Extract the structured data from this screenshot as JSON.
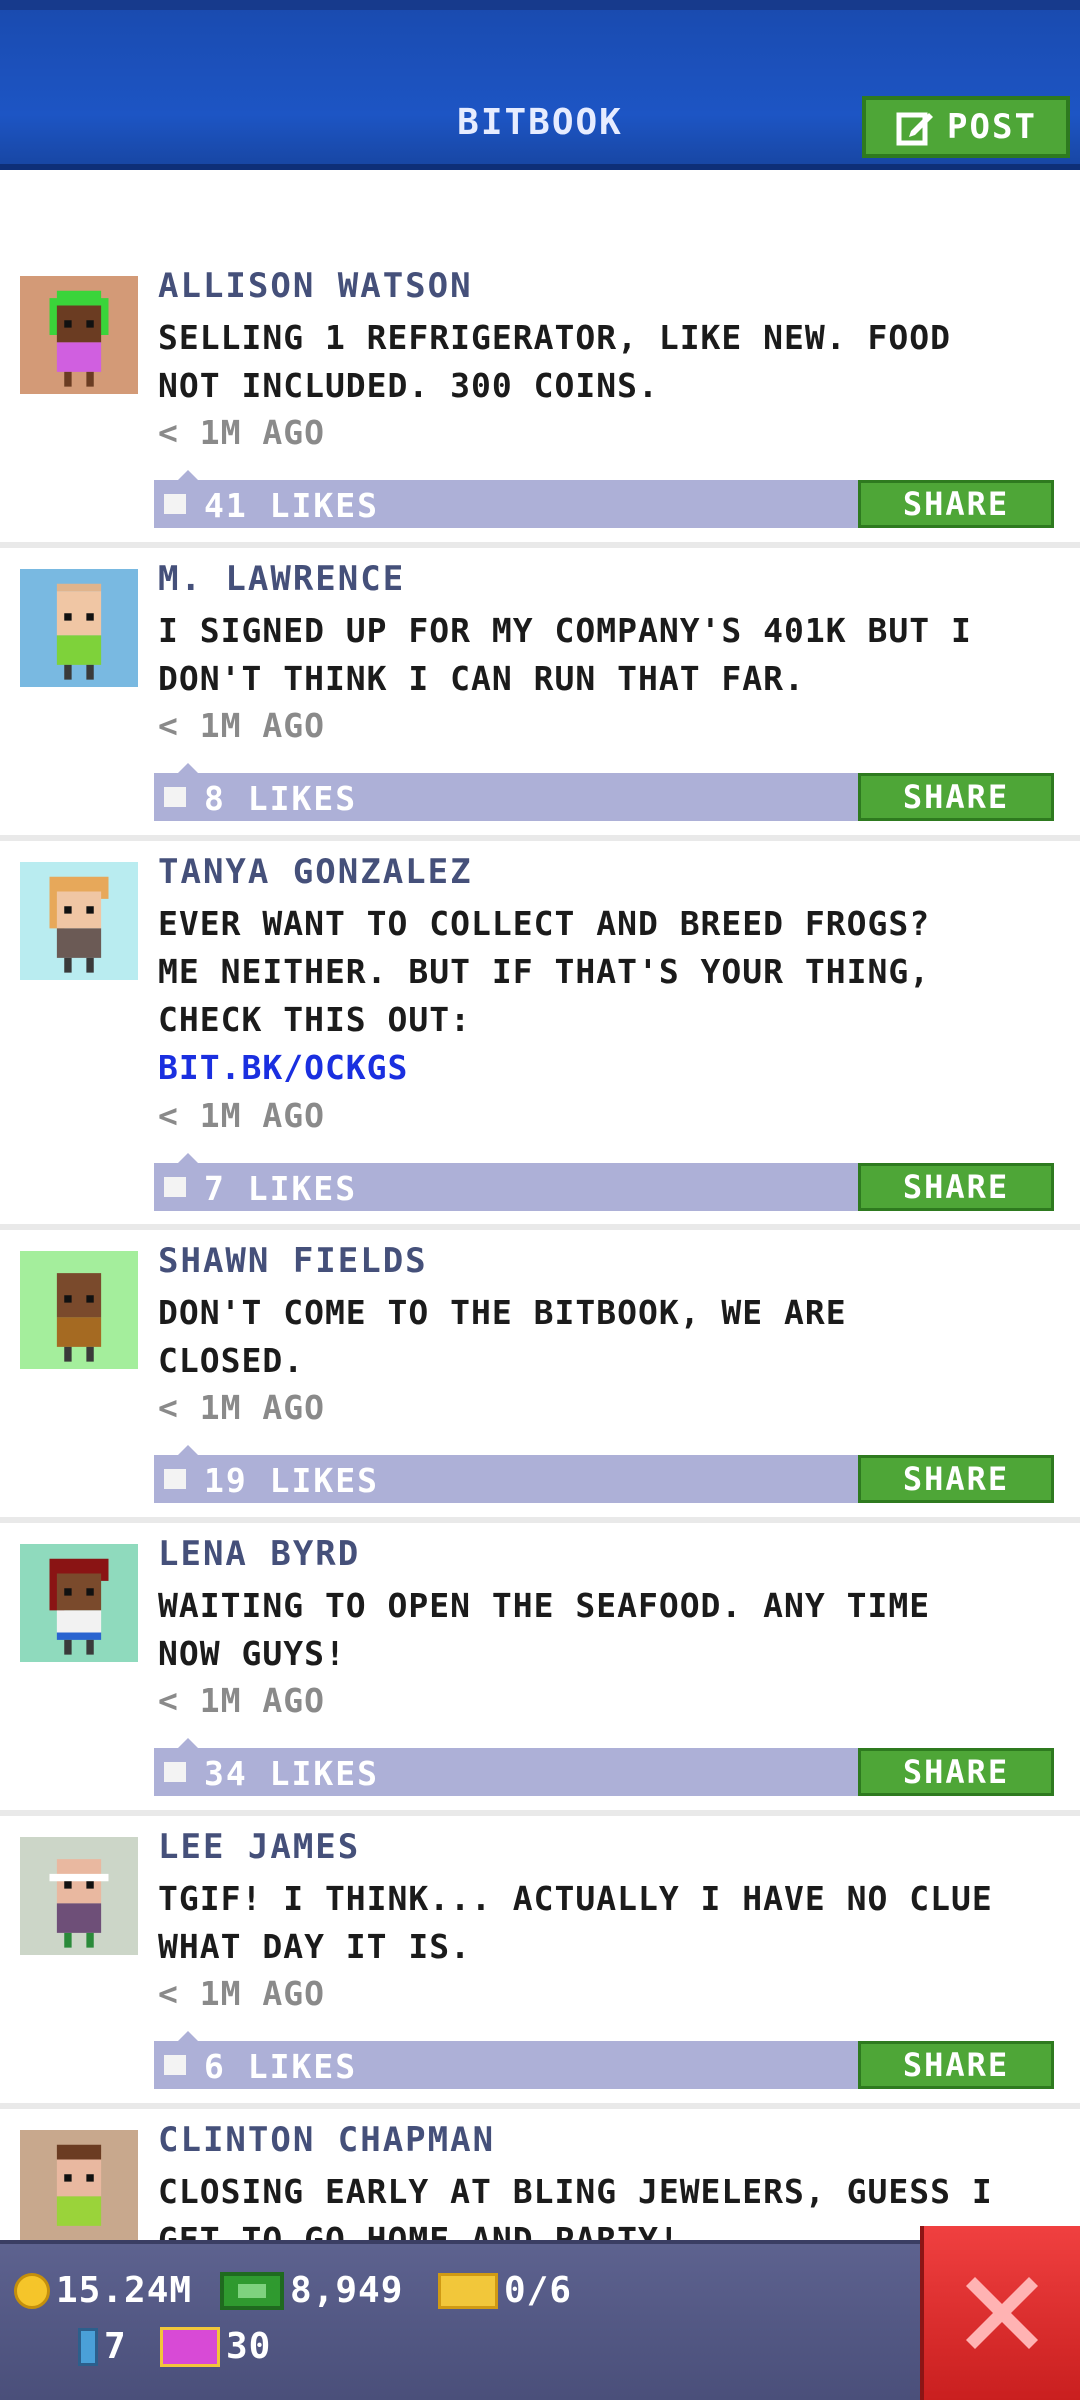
{
  "header": {
    "title": "BITBOOK",
    "post_label": "POST"
  },
  "posts": [
    {
      "author": "ALLISON WATSON",
      "text": "SELLING 1 REFRIGERATOR, LIKE NEW. FOOD\nNOT INCLUDED. 300 COINS.",
      "time": "< 1M AGO",
      "likes": "41 LIKES",
      "share": "SHARE",
      "avatar_bg": "#d39a77"
    },
    {
      "author": "M. LAWRENCE",
      "text": "I SIGNED UP FOR MY COMPANY'S 401K BUT I\nDON'T THINK I CAN RUN THAT FAR.",
      "time": "< 1M AGO",
      "likes": "8 LIKES",
      "share": "SHARE",
      "avatar_bg": "#79b9e1"
    },
    {
      "author": "TANYA GONZALEZ",
      "text": "EVER WANT TO COLLECT AND BREED FROGS?\nME NEITHER. BUT IF THAT'S YOUR THING,\nCHECK THIS OUT:",
      "link": "BIT.BK/OCKGS",
      "time": "< 1M AGO",
      "likes": "7 LIKES",
      "share": "SHARE",
      "avatar_bg": "#b9ecf0"
    },
    {
      "author": "SHAWN FIELDS",
      "text": "DON'T COME TO THE BITBOOK, WE ARE\nCLOSED.",
      "time": "< 1M AGO",
      "likes": "19 LIKES",
      "share": "SHARE",
      "avatar_bg": "#a4ee9c"
    },
    {
      "author": "LENA BYRD",
      "text": "WAITING TO OPEN THE SEAFOOD. ANY TIME\nNOW GUYS!",
      "time": "< 1M AGO",
      "likes": "34 LIKES",
      "share": "SHARE",
      "avatar_bg": "#8fdabd"
    },
    {
      "author": "LEE JAMES",
      "text": "TGIF! I THINK... ACTUALLY I HAVE NO CLUE\nWHAT DAY IT IS.",
      "time": "< 1M AGO",
      "likes": "6 LIKES",
      "share": "SHARE",
      "avatar_bg": "#ccd6c8"
    },
    {
      "author": "CLINTON CHAPMAN",
      "text": "CLOSING EARLY AT BLING JEWELERS, GUESS I\nGET TO GO HOME AND PARTY!",
      "avatar_bg": "#c8a88d"
    }
  ],
  "stats": {
    "coins": "15.24M",
    "bux": "8,949",
    "crates": "0/6",
    "tubes": "7",
    "tickets": "30"
  }
}
